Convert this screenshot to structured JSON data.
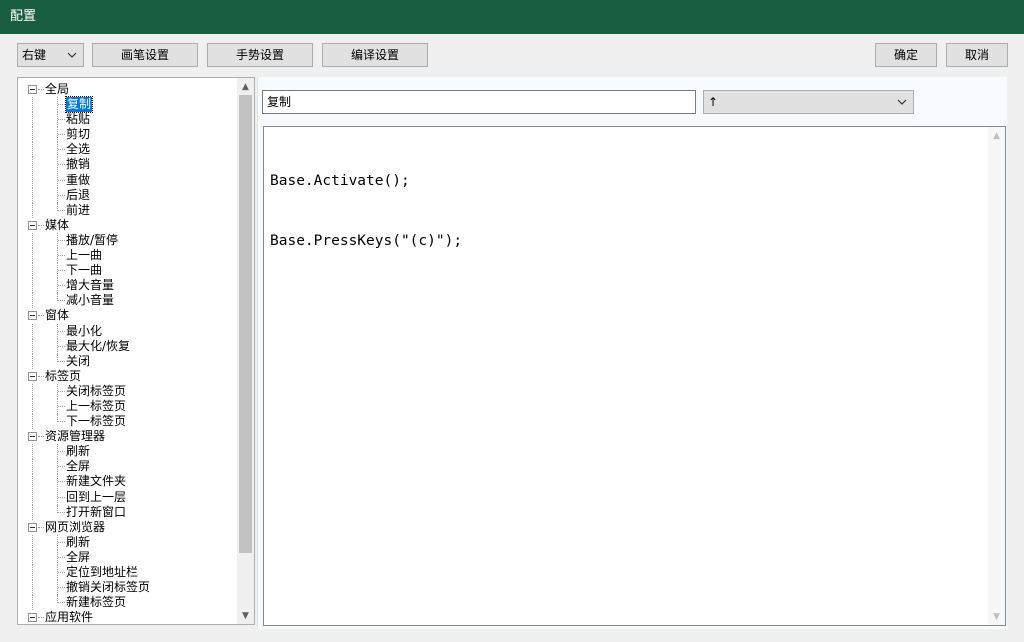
{
  "window": {
    "title": "配置"
  },
  "toolbar": {
    "mouse_button_select": "右键",
    "pen_settings": "画笔设置",
    "gesture_settings": "手势设置",
    "compile_settings": "编译设置",
    "ok": "确定",
    "cancel": "取消"
  },
  "tree": {
    "groups": [
      {
        "label": "全局",
        "children": [
          "复制",
          "粘贴",
          "剪切",
          "全选",
          "撤销",
          "重做",
          "后退",
          "前进"
        ]
      },
      {
        "label": "媒体",
        "children": [
          "播放/暂停",
          "上一曲",
          "下一曲",
          "增大音量",
          "减小音量"
        ]
      },
      {
        "label": "窗体",
        "children": [
          "最小化",
          "最大化/恢复",
          "关闭"
        ]
      },
      {
        "label": "标签页",
        "children": [
          "关闭标签页",
          "上一标签页",
          "下一标签页"
        ]
      },
      {
        "label": "资源管理器",
        "children": [
          "刷新",
          "全屏",
          "新建文件夹",
          "回到上一层",
          "打开新窗口"
        ]
      },
      {
        "label": "网页浏览器",
        "children": [
          "刷新",
          "全屏",
          "定位到地址栏",
          "撤销关闭标签页",
          "新建标签页"
        ]
      },
      {
        "label": "应用软件",
        "children": []
      }
    ],
    "selected": "复制"
  },
  "editor": {
    "name_value": "复制",
    "gesture_value": "↑",
    "code_lines": [
      "Base.Activate();",
      "Base.PressKeys(\"(c)\");"
    ]
  }
}
